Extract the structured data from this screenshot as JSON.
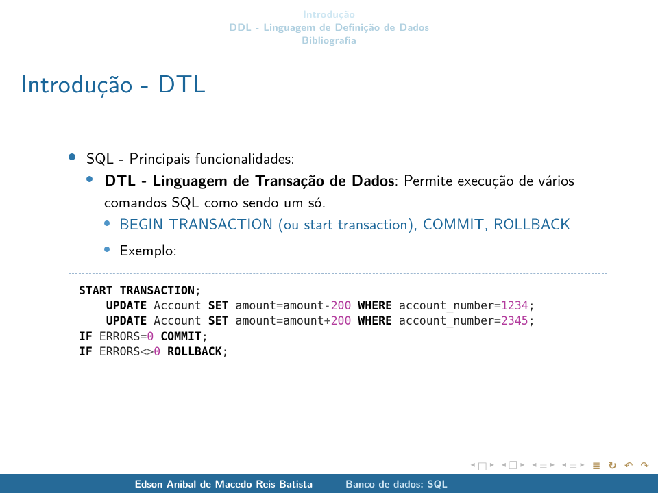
{
  "header": {
    "line1": "Introdução",
    "line2": "DDL - Linguagem de Definição de Dados",
    "line3": "Bibliografia"
  },
  "frametitle": "Introdução - DTL",
  "bullets": {
    "l1": "SQL - Principais funcionalidades:",
    "l2_label": "DTL - Linguagem de Transação de Dados",
    "l2_rest": ": Permite execução de vários comandos SQL como sendo um só.",
    "l3a_cmds": "BEGIN TRANSACTION (ou start transaction), COMMIT, ROLLBACK",
    "l3b": "Exemplo:"
  },
  "code": {
    "line1_kw1": "START",
    "line1_kw2": "TRANSACTION",
    "line1_tail": ";",
    "line2_indent": "    ",
    "line2_kw1": "UPDATE",
    "line2_t1": " Account ",
    "line2_kw2": "SET",
    "line2_t2": " amount",
    "line2_eq": "=",
    "line2_t3": "amount",
    "line2_minus": "-",
    "line2_n1": "200",
    "line2_sp": " ",
    "line2_kw3": "WHERE",
    "line2_t4": " account_number",
    "line2_eq2": "=",
    "line2_n2": "1234",
    "line2_tail": ";",
    "line3_indent": "    ",
    "line3_kw1": "UPDATE",
    "line3_t1": " Account ",
    "line3_kw2": "SET",
    "line3_t2": " amount",
    "line3_eq": "=",
    "line3_t3": "amount",
    "line3_plus": "+",
    "line3_n1": "200",
    "line3_sp": " ",
    "line3_kw3": "WHERE",
    "line3_t4": " account_number",
    "line3_eq2": "=",
    "line3_n2": "2345",
    "line3_tail": ";",
    "line4_kw": "IF",
    "line4_t": " ERRORS",
    "line4_eq": "=",
    "line4_n": "0",
    "line4_sp": " ",
    "line4_kw2": "COMMIT",
    "line4_tail": ";",
    "line5_kw": "IF",
    "line5_t": " ERRORS",
    "line5_ne": "<>",
    "line5_n": "0",
    "line5_sp": " ",
    "line5_kw2": "ROLLBACK",
    "line5_tail": ";"
  },
  "footer": {
    "author": "Edson Anibal de Macedo Reis Batista",
    "title": "Banco de dados: SQL"
  },
  "nav": {
    "slide_back": "◂",
    "slide_box": "□",
    "slide_fwd": "▸",
    "frame_back": "◂",
    "frame_box": "❐",
    "frame_fwd": "▸",
    "sub_back": "◂",
    "sub_mark": "≡",
    "sub_fwd": "▸",
    "sec_back": "◂",
    "sec_mark": "≡",
    "sec_fwd": "▸",
    "doc_mark": "≣",
    "loop": "↻",
    "undo": "↶",
    "redo": "↷"
  }
}
